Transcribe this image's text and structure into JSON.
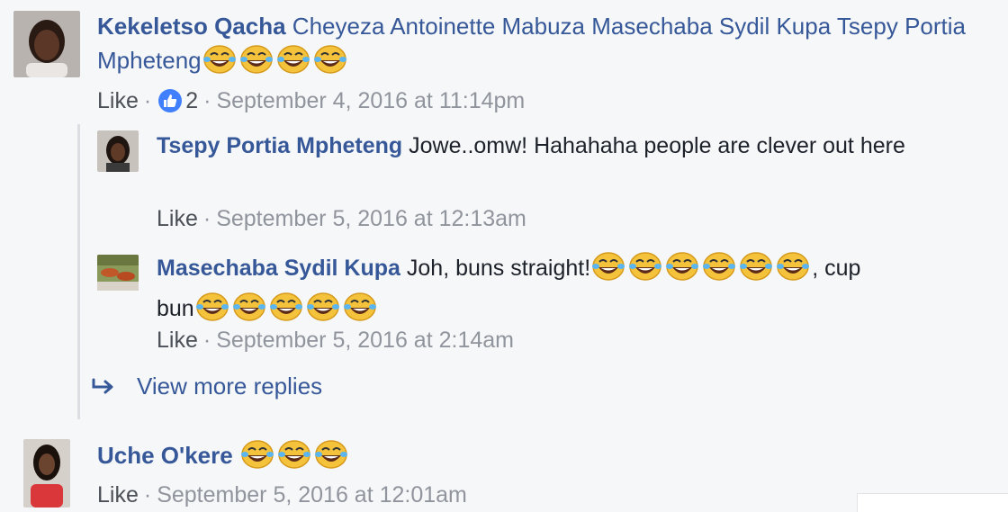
{
  "comments": [
    {
      "author": "Kekeletso Qacha",
      "text_before": "Cheyeza Antoinette Mabuza Masechaba Sydil Kupa Tsepy Portia Mpheteng",
      "emoji_count": 4,
      "like_label": "Like",
      "like_count": "2",
      "timestamp": "September 4, 2016 at 11:14pm"
    }
  ],
  "replies": [
    {
      "author": "Tsepy Portia Mpheteng",
      "text": "Jowe..omw! Hahahaha people are clever out here",
      "like_label": "Like",
      "timestamp": "September 5, 2016 at 12:13am"
    },
    {
      "author": "Masechaba Sydil Kupa",
      "text_before": "Joh, buns straight!",
      "text_middle": ", cup",
      "text_after": "bun",
      "like_label": "Like",
      "timestamp": "September 5, 2016 at 2:14am"
    }
  ],
  "view_more": "View more replies",
  "second_comment": {
    "author": "Uche O'kere",
    "like_label": "Like",
    "timestamp": "September 5, 2016 at 12:01am"
  },
  "icons": {
    "laughing_emoji": "tears-of-joy-emoji",
    "like_badge": "thumbs-up-icon",
    "reply_arrow": "reply-arrow-icon"
  },
  "colors": {
    "name_link": "#365899",
    "meta_gray": "#90949c",
    "like_blue": "#4080ff",
    "background": "#f6f7f9"
  }
}
